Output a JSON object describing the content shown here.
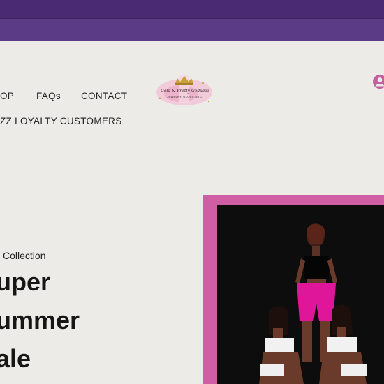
{
  "announcement_bar": {
    "color": "#4a2a73",
    "secondary_color": "#5b3a86"
  },
  "nav": {
    "items": [
      {
        "label": "OP"
      },
      {
        "label": "FAQs"
      },
      {
        "label": "CONTACT"
      }
    ],
    "second_row": "ZZ LOYALTY CUSTOMERS"
  },
  "logo": {
    "text_line1": "Gold & Pretty Goddezz",
    "text_line2": "JEWELRY, GLOSS, ETC."
  },
  "account": {
    "icon": "user-icon"
  },
  "hero": {
    "eyebrow": "Collection",
    "lines": [
      "uper",
      "ummer",
      "ale"
    ],
    "frame_color": "#cf5ea4"
  },
  "photo": {
    "background": "#0d0d0d",
    "accent": "#e0169a"
  }
}
